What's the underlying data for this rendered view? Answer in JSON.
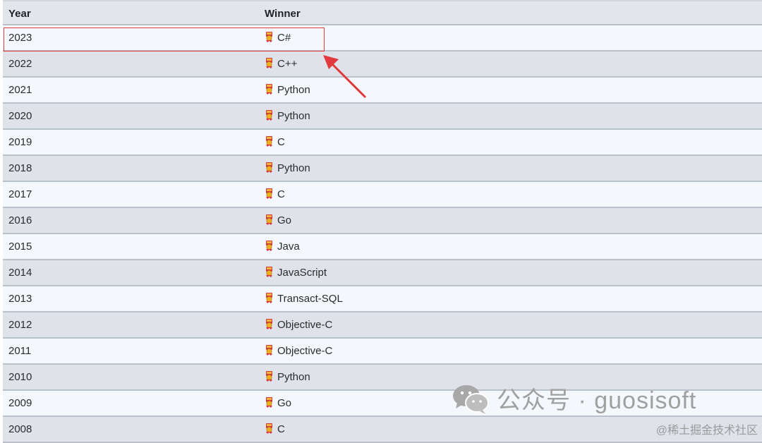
{
  "table": {
    "headers": {
      "year": "Year",
      "winner": "Winner"
    },
    "rows": [
      {
        "year": "2023",
        "winner": "C#"
      },
      {
        "year": "2022",
        "winner": "C++"
      },
      {
        "year": "2021",
        "winner": "Python"
      },
      {
        "year": "2020",
        "winner": "Python"
      },
      {
        "year": "2019",
        "winner": "C"
      },
      {
        "year": "2018",
        "winner": "Python"
      },
      {
        "year": "2017",
        "winner": "C"
      },
      {
        "year": "2016",
        "winner": "Go"
      },
      {
        "year": "2015",
        "winner": "Java"
      },
      {
        "year": "2014",
        "winner": "JavaScript"
      },
      {
        "year": "2013",
        "winner": "Transact-SQL"
      },
      {
        "year": "2012",
        "winner": "Objective-C"
      },
      {
        "year": "2011",
        "winner": "Objective-C"
      },
      {
        "year": "2010",
        "winner": "Python"
      },
      {
        "year": "2009",
        "winner": "Go"
      },
      {
        "year": "2008",
        "winner": "C"
      }
    ],
    "row_icon": "medal-icon"
  },
  "annotation": {
    "highlight_color": "#e0393e"
  },
  "watermark": {
    "primary": "公众号 · guosisoft",
    "secondary": "@稀土掘金技术社区",
    "icon": "wechat-icon"
  },
  "colors": {
    "row_light": "#f4f8fd",
    "row_dark": "#dfe3e9",
    "header_bg": "#e2e6ec"
  }
}
